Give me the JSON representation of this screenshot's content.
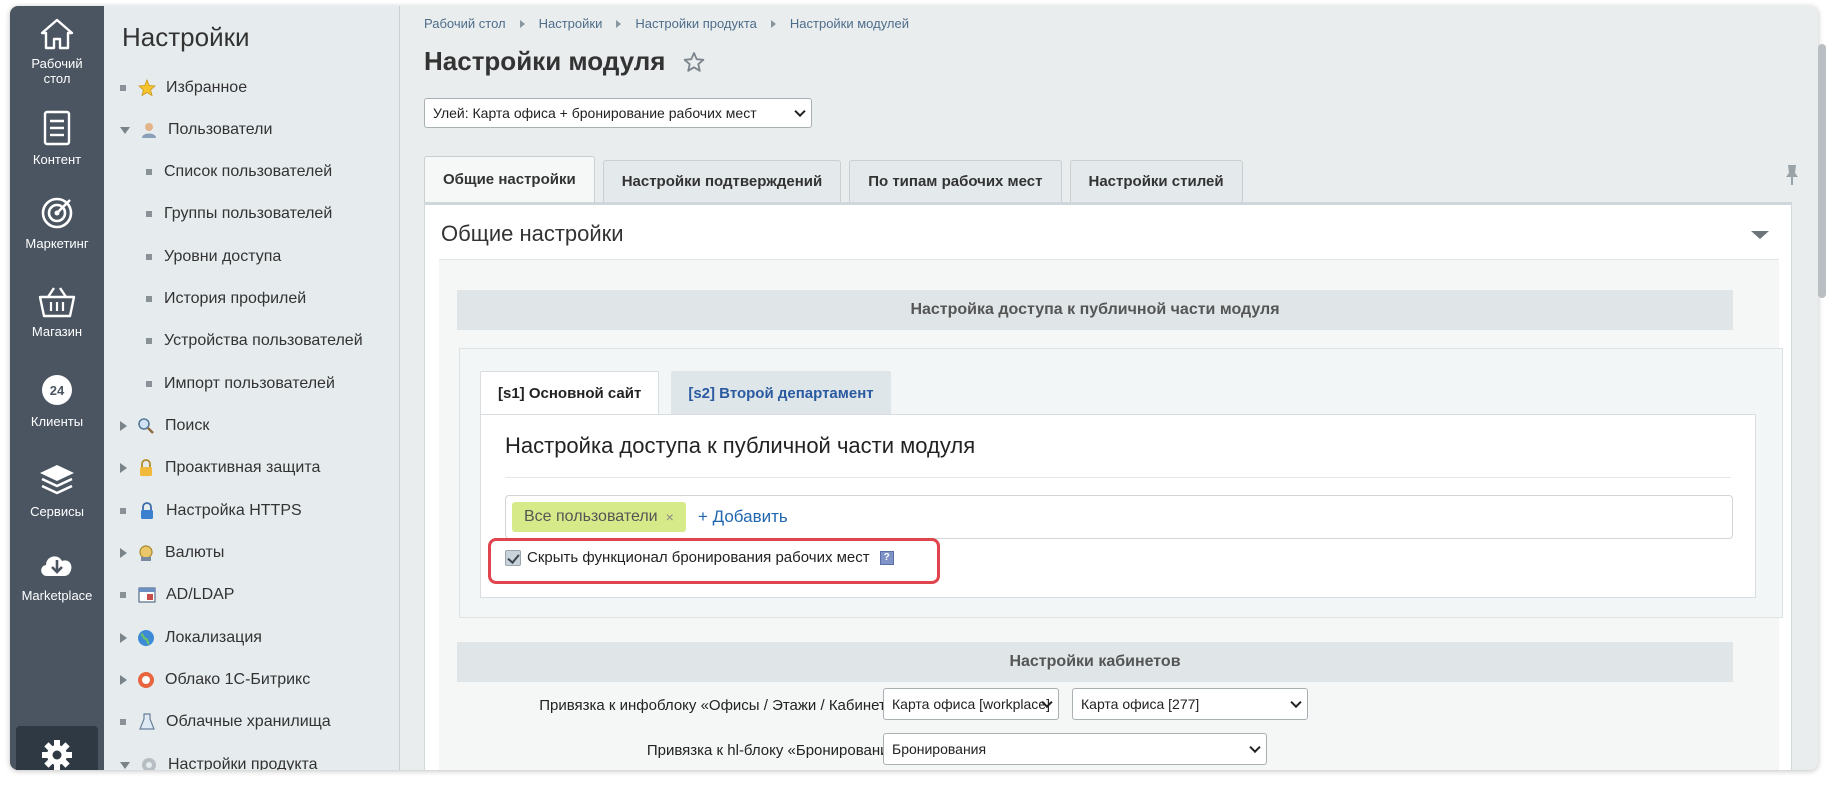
{
  "rail": {
    "items": [
      {
        "label": "Рабочий стол",
        "icon": "home-icon"
      },
      {
        "label": "Контент",
        "icon": "document-icon"
      },
      {
        "label": "Маркетинг",
        "icon": "target-icon"
      },
      {
        "label": "Магазин",
        "icon": "basket-icon"
      },
      {
        "label": "Клиенты",
        "icon": "clock-24-icon"
      },
      {
        "label": "Сервисы",
        "icon": "layers-icon"
      },
      {
        "label": "Marketplace",
        "icon": "cloud-download-icon"
      },
      {
        "label": "",
        "icon": "gear-icon"
      }
    ]
  },
  "menu": {
    "title": "Настройки",
    "items": [
      {
        "label": "Избранное",
        "marker": "bullet",
        "icon": "star-icon",
        "level": 0
      },
      {
        "label": "Пользователи",
        "marker": "arrow-down",
        "icon": "user-icon",
        "level": 0
      },
      {
        "label": "Список пользователей",
        "marker": "bullet",
        "level": 1
      },
      {
        "label": "Группы пользователей",
        "marker": "bullet",
        "level": 1
      },
      {
        "label": "Уровни доступа",
        "marker": "bullet",
        "level": 1
      },
      {
        "label": "История профилей",
        "marker": "bullet",
        "level": 1
      },
      {
        "label": "Устройства пользователей",
        "marker": "bullet",
        "level": 1
      },
      {
        "label": "Импорт пользователей",
        "marker": "bullet",
        "level": 1
      },
      {
        "label": "Поиск",
        "marker": "arrow-right",
        "icon": "search-icon",
        "level": 0
      },
      {
        "label": "Проактивная защита",
        "marker": "arrow-right",
        "icon": "lock-icon",
        "level": 0
      },
      {
        "label": "Настройка HTTPS",
        "marker": "bullet",
        "icon": "https-lock-icon",
        "level": 0
      },
      {
        "label": "Валюты",
        "marker": "arrow-right",
        "icon": "coin-icon",
        "level": 0
      },
      {
        "label": "AD/LDAP",
        "marker": "bullet",
        "icon": "ldap-icon",
        "level": 0
      },
      {
        "label": "Локализация",
        "marker": "arrow-right",
        "icon": "globe-icon",
        "level": 0
      },
      {
        "label": "Облако 1С-Битрикс",
        "marker": "arrow-right",
        "icon": "cloud-icon",
        "level": 0
      },
      {
        "label": "Облачные хранилища",
        "marker": "bullet",
        "icon": "storage-icon",
        "level": 0
      },
      {
        "label": "Настройки продукта",
        "marker": "arrow-down",
        "icon": "settings-icon",
        "level": 0
      }
    ]
  },
  "breadcrumb": [
    "Рабочий стол",
    "Настройки",
    "Настройки продукта",
    "Настройки модулей"
  ],
  "page": {
    "title": "Настройки модуля",
    "module_select": "Улей: Карта офиса + бронирование рабочих мест"
  },
  "tabs": [
    "Общие настройки",
    "Настройки подтверждений",
    "По типам рабочих мест",
    "Настройки стилей"
  ],
  "panel": {
    "title": "Общие настройки",
    "access_header": "Настройка доступа к публичной части модуля",
    "site_tabs": [
      "[s1] Основной сайт",
      "[s2] Второй департамент"
    ],
    "access_title": "Настройка доступа к публичной части модуля",
    "chip": "Все пользователи",
    "chip_remove": "×",
    "add_link": "+ Добавить",
    "hide_checkbox_label": "Скрыть функционал бронирования рабочих мест",
    "help": "?",
    "cabinets_header": "Настройки кабинетов",
    "iblock_label": "Привязка к инфоблоку «Офисы / Этажи / Кабинеты»",
    "iblock_type_value": "Карта офиса [workplace]",
    "iblock_value": "Карта офиса [277]",
    "hlblock_label": "Привязка к hl-блоку «Бронирования»",
    "hlblock_value": "Бронирования"
  },
  "colors": {
    "rail": "#4a5561",
    "chip": "#d7ea8a",
    "link": "#2067b0",
    "highlight": "#e0454d"
  }
}
